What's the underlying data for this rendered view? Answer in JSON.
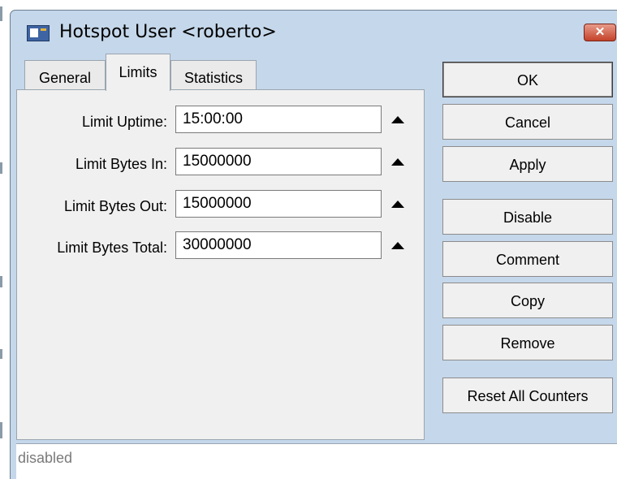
{
  "window": {
    "title": "Hotspot User <roberto>",
    "close_icon": "close-x-icon"
  },
  "tabs": [
    {
      "label": "General",
      "active": false
    },
    {
      "label": "Limits",
      "active": true
    },
    {
      "label": "Statistics",
      "active": false
    }
  ],
  "fields": [
    {
      "label": "Limit Uptime:",
      "value": "15:00:00"
    },
    {
      "label": "Limit Bytes In:",
      "value": "15000000"
    },
    {
      "label": "Limit Bytes Out:",
      "value": "15000000"
    },
    {
      "label": "Limit Bytes Total:",
      "value": "30000000"
    }
  ],
  "buttons": {
    "ok": "OK",
    "cancel": "Cancel",
    "apply": "Apply",
    "disable": "Disable",
    "comment": "Comment",
    "copy": "Copy",
    "remove": "Remove",
    "reset_all_counters": "Reset All Counters"
  },
  "status": {
    "text": "disabled"
  },
  "colors": {
    "window_frame": "#c5d7ea",
    "panel": "#f0f0f0",
    "close_button": "#c4412a"
  }
}
